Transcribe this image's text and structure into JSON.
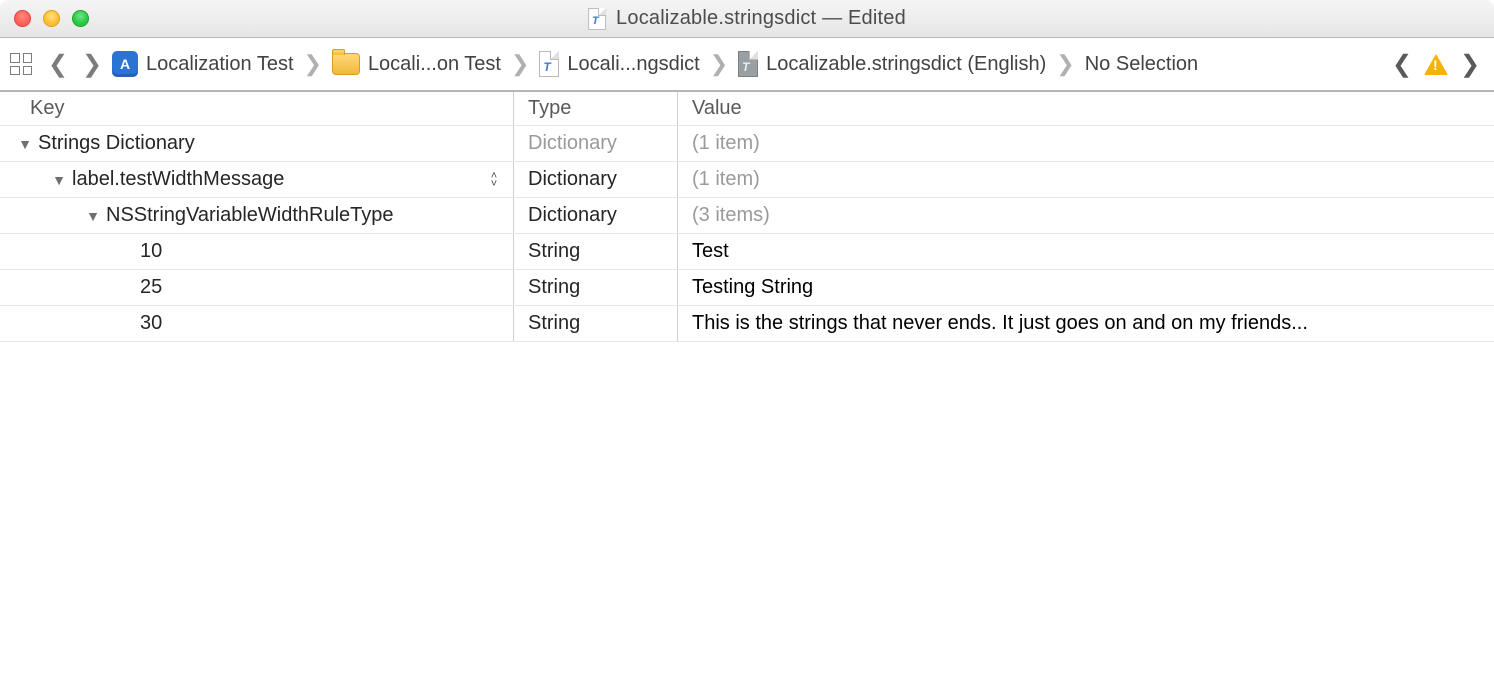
{
  "window": {
    "title": "Localizable.stringsdict — Edited"
  },
  "jumpbar": {
    "crumbs": [
      {
        "label": "Localization Test"
      },
      {
        "label": "Locali...on Test"
      },
      {
        "label": "Locali...ngsdict"
      },
      {
        "label": "Localizable.stringsdict (English)"
      },
      {
        "label": "No Selection"
      }
    ]
  },
  "columns": {
    "key": "Key",
    "type": "Type",
    "value": "Value"
  },
  "rows": [
    {
      "indent": 0,
      "disclosure": "down",
      "key": "Strings Dictionary",
      "type": "Dictionary",
      "type_dim": true,
      "value": "(1 item)",
      "value_dim": true,
      "stepper": false
    },
    {
      "indent": 1,
      "disclosure": "down",
      "key": "label.testWidthMessage",
      "type": "Dictionary",
      "type_dim": false,
      "value": "(1 item)",
      "value_dim": true,
      "stepper": true
    },
    {
      "indent": 2,
      "disclosure": "down",
      "key": "NSStringVariableWidthRuleType",
      "type": "Dictionary",
      "type_dim": false,
      "value": "(3 items)",
      "value_dim": true,
      "stepper": false
    },
    {
      "indent": 3,
      "disclosure": "none",
      "key": "10",
      "type": "String",
      "type_dim": false,
      "value": "Test",
      "value_dim": false,
      "stepper": false
    },
    {
      "indent": 3,
      "disclosure": "none",
      "key": "25",
      "type": "String",
      "type_dim": false,
      "value": "Testing String",
      "value_dim": false,
      "stepper": false
    },
    {
      "indent": 3,
      "disclosure": "none",
      "key": "30",
      "type": "String",
      "type_dim": false,
      "value": "This is the strings that never ends. It just goes on and on my friends...",
      "value_dim": false,
      "stepper": false
    }
  ]
}
